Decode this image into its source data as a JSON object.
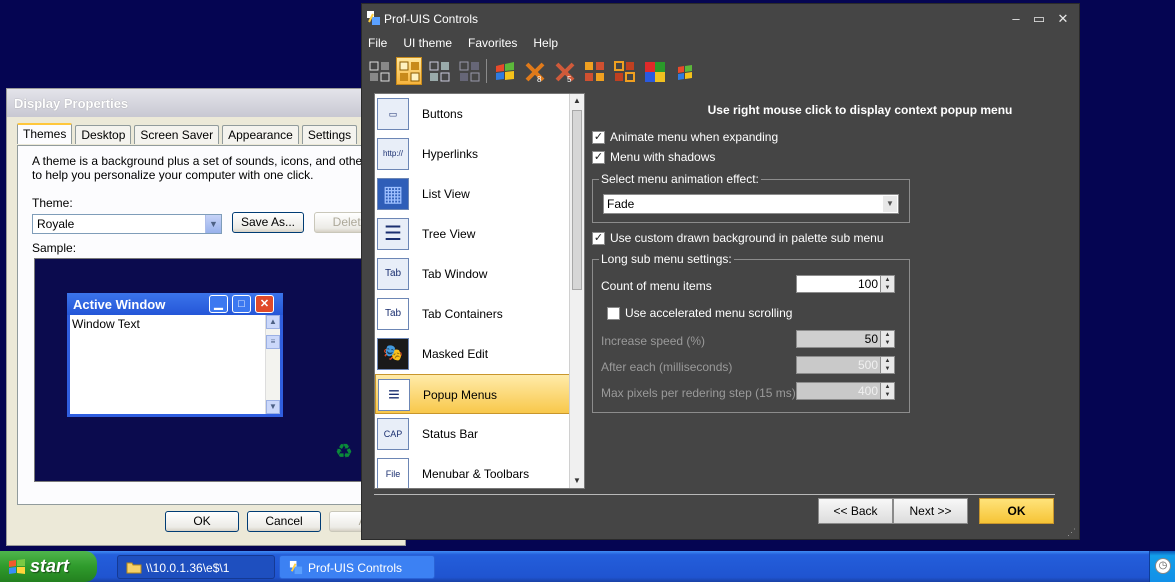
{
  "display_properties": {
    "title": "Display Properties",
    "tabs": [
      "Themes",
      "Desktop",
      "Screen Saver",
      "Appearance",
      "Settings"
    ],
    "description_line1": "A theme is a background plus a set of sounds, icons, and other elemen",
    "description_line2": "to help you personalize your computer with one click.",
    "theme_label": "Theme:",
    "theme_value": "Royale",
    "save_as_label": "Save As...",
    "delete_label": "Delete",
    "sample_label": "Sample:",
    "active_window_title": "Active Window",
    "window_text": "Window Text",
    "ok_label": "OK",
    "cancel_label": "Cancel",
    "apply_label": "Ap"
  },
  "profuis": {
    "title": "Prof-UIS Controls",
    "menu": [
      "File",
      "UI theme",
      "Favorites",
      "Help"
    ],
    "toolbar_active_index": 1,
    "list_items": [
      {
        "label": "Buttons",
        "icon": "buttons-icon",
        "glyph": "▭"
      },
      {
        "label": "Hyperlinks",
        "icon": "hyperlinks-icon",
        "glyph": "http://"
      },
      {
        "label": "List View",
        "icon": "list-view-icon",
        "glyph": "▦"
      },
      {
        "label": "Tree View",
        "icon": "tree-view-icon",
        "glyph": "☰"
      },
      {
        "label": "Tab Window",
        "icon": "tab-window-icon",
        "glyph": "Tab"
      },
      {
        "label": "Tab Containers",
        "icon": "tab-containers-icon",
        "glyph": "Tab"
      },
      {
        "label": "Masked Edit",
        "icon": "masked-edit-icon",
        "glyph": "🎭"
      },
      {
        "label": "Popup Menus",
        "icon": "popup-menus-icon",
        "glyph": "≡"
      },
      {
        "label": "Status Bar",
        "icon": "status-bar-icon",
        "glyph": "CAP"
      },
      {
        "label": "Menubar & Toolbars",
        "icon": "menubar-toolbars-icon",
        "glyph": "File"
      }
    ],
    "selected_item": "Popup Menus",
    "heading": "Use right mouse click to display context popup menu",
    "animate_menu_label": "Animate menu when expanding",
    "animate_menu_checked": true,
    "menu_shadows_label": "Menu with shadows",
    "menu_shadows_checked": true,
    "animation_group_title": "Select menu animation effect:",
    "animation_effect": "Fade",
    "custom_bg_label": "Use custom drawn background in palette sub menu",
    "custom_bg_checked": true,
    "long_sub_title": "Long sub menu settings:",
    "count_label": "Count of menu items",
    "count_value": "100",
    "accelerated_label": "Use accelerated menu scrolling",
    "accelerated_checked": false,
    "increase_speed_label": "Increase speed (%)",
    "increase_speed_value": "50",
    "after_each_label": "After each (milliseconds)",
    "after_each_value": "500",
    "max_pixels_label": "Max pixels per redering step (15 ms)",
    "max_pixels_value": "400",
    "back_label": "<< Back",
    "next_label": "Next >>",
    "ok_label": "OK"
  },
  "taskbar": {
    "start_label": "start",
    "task1_label": "\\\\10.0.1.36\\e$\\1",
    "task2_label": "Prof-UIS Controls"
  },
  "colors": {
    "desktop": "#050552",
    "window_dark": "#454545",
    "selection": "#f8c84b",
    "taskbar_blue": "#245edb",
    "start_green": "#2f9b2c"
  }
}
